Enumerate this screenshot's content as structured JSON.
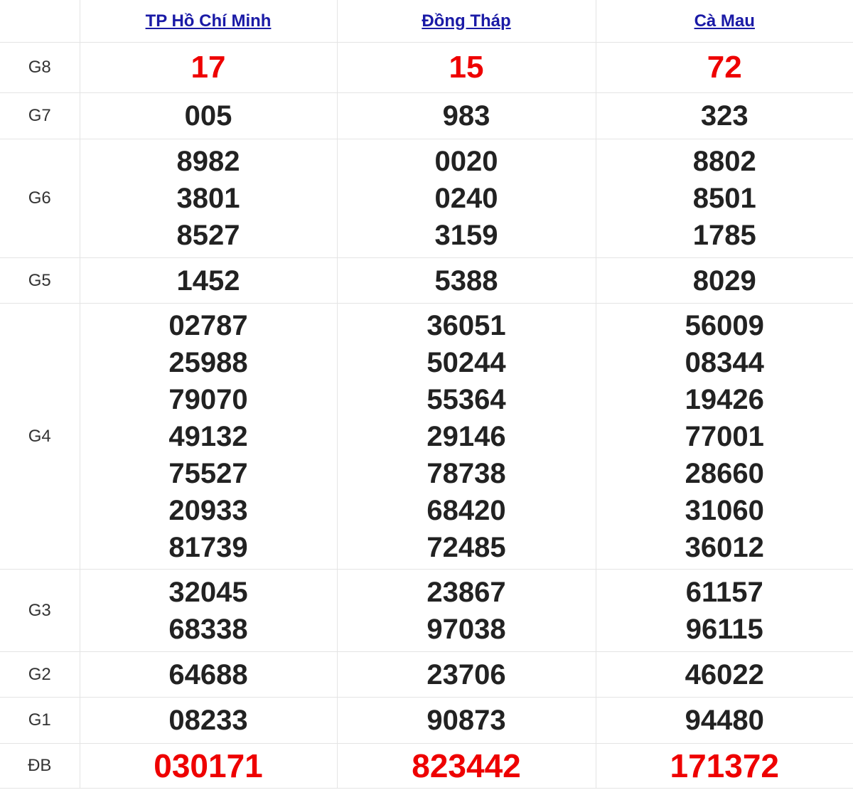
{
  "provinces": [
    "TP Hồ Chí Minh",
    "Đồng Tháp",
    "Cà Mau"
  ],
  "accent_red": "#ee0000",
  "link_color": "#1a1aa6",
  "rows": {
    "g8": {
      "label": "G8",
      "values": [
        [
          "17"
        ],
        [
          "15"
        ],
        [
          "72"
        ]
      ]
    },
    "g7": {
      "label": "G7",
      "values": [
        [
          "005"
        ],
        [
          "983"
        ],
        [
          "323"
        ]
      ]
    },
    "g6": {
      "label": "G6",
      "values": [
        [
          "8982",
          "3801",
          "8527"
        ],
        [
          "0020",
          "0240",
          "3159"
        ],
        [
          "8802",
          "8501",
          "1785"
        ]
      ]
    },
    "g5": {
      "label": "G5",
      "values": [
        [
          "1452"
        ],
        [
          "5388"
        ],
        [
          "8029"
        ]
      ]
    },
    "g4": {
      "label": "G4",
      "values": [
        [
          "02787",
          "25988",
          "79070",
          "49132",
          "75527",
          "20933",
          "81739"
        ],
        [
          "36051",
          "50244",
          "55364",
          "29146",
          "78738",
          "68420",
          "72485"
        ],
        [
          "56009",
          "08344",
          "19426",
          "77001",
          "28660",
          "31060",
          "36012"
        ]
      ]
    },
    "g3": {
      "label": "G3",
      "values": [
        [
          "32045",
          "68338"
        ],
        [
          "23867",
          "97038"
        ],
        [
          "61157",
          "96115"
        ]
      ]
    },
    "g2": {
      "label": "G2",
      "values": [
        [
          "64688"
        ],
        [
          "23706"
        ],
        [
          "46022"
        ]
      ]
    },
    "g1": {
      "label": "G1",
      "values": [
        [
          "08233"
        ],
        [
          "90873"
        ],
        [
          "94480"
        ]
      ]
    },
    "db": {
      "label": "ĐB",
      "values": [
        [
          "030171"
        ],
        [
          "823442"
        ],
        [
          "171372"
        ]
      ]
    }
  }
}
